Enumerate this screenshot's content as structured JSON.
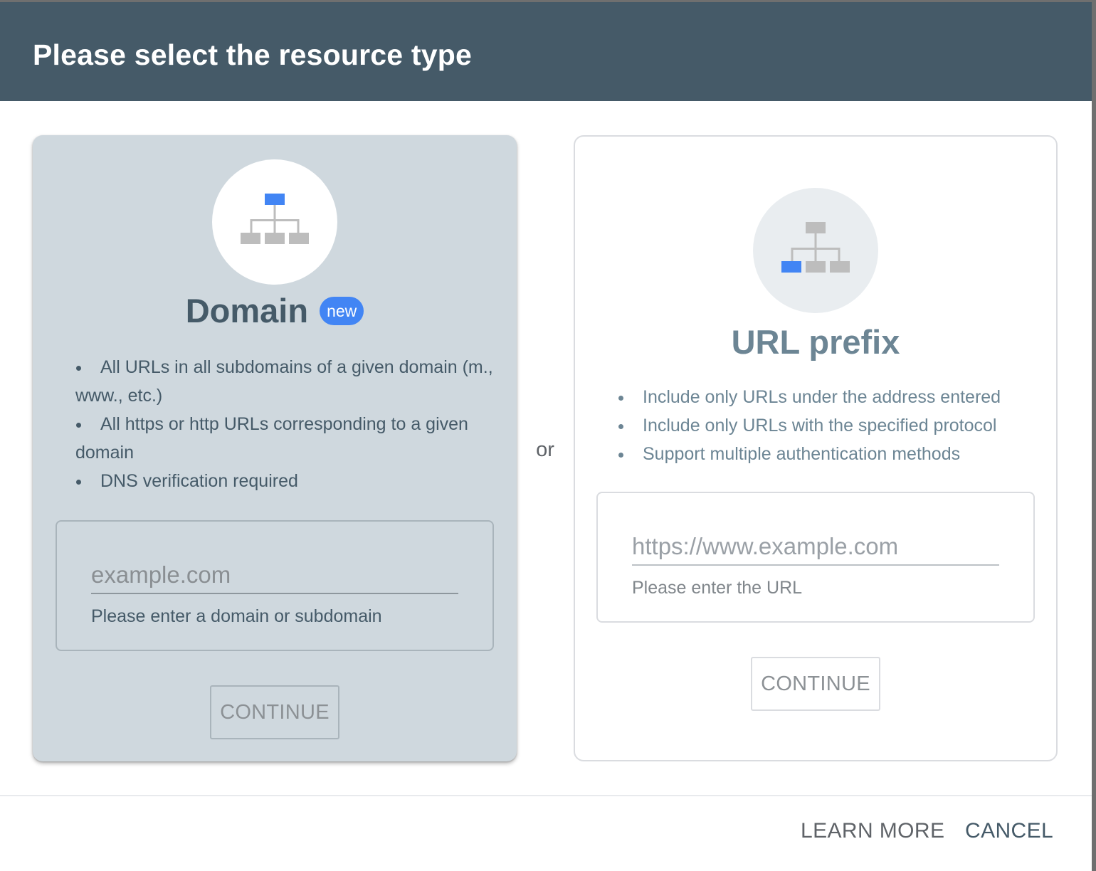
{
  "dialog": {
    "title": "Please select the resource type"
  },
  "domain_card": {
    "icon": "sitemap-top-highlighted-icon",
    "title": "Domain",
    "badge": "new",
    "features": [
      "All URLs in all subdomains of a given domain (m., www., etc.)",
      "All https or http URLs corresponding to a given domain",
      "DNS verification required"
    ],
    "input_value": "",
    "input_placeholder": "example.com",
    "helper_text": "Please enter a domain or subdomain",
    "continue_label": "CONTINUE"
  },
  "separator": "or",
  "url_card": {
    "icon": "sitemap-leaf-highlighted-icon",
    "title": "URL prefix",
    "features": [
      "Include only URLs under the address entered",
      "Include only URLs with the specified protocol",
      "Support multiple authentication methods"
    ],
    "input_value": "",
    "input_placeholder": "https://www.example.com",
    "helper_text": "Please enter the URL",
    "continue_label": "CONTINUE"
  },
  "footer": {
    "learn_more_label": "LEARN MORE",
    "cancel_label": "CANCEL"
  },
  "colors": {
    "header_bg": "#455a68",
    "accent_blue": "#4285f4",
    "domain_card_bg": "#cfd8de",
    "icon_gray": "#bdbdbd"
  }
}
